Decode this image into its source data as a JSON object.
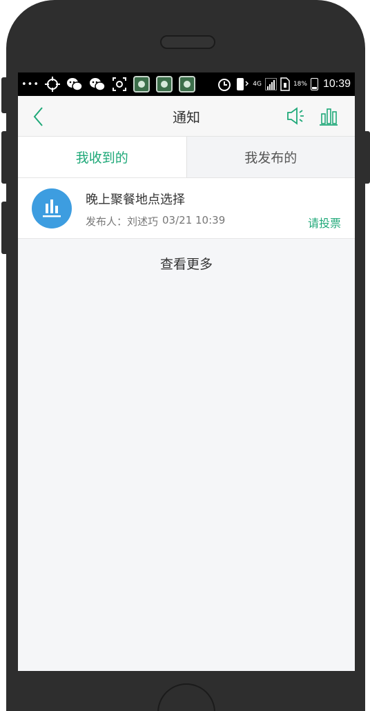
{
  "status_bar": {
    "icons": [
      "more-dots-icon",
      "gps-icon",
      "wechat-icon",
      "wechat-icon",
      "screenshot-icon",
      "app-icon",
      "app-icon",
      "app-icon",
      "alarm-icon",
      "vibrate-icon",
      "signal-icon",
      "sim-icon",
      "battery-icon"
    ],
    "network_label": "4G",
    "battery_percent": "18%",
    "time": "10:39"
  },
  "header": {
    "title": "通知",
    "back_icon": "chevron-left-icon",
    "right_icons": [
      "speaker-icon",
      "bar-chart-icon"
    ]
  },
  "tabs": [
    {
      "label": "我收到的",
      "active": true
    },
    {
      "label": "我发布的",
      "active": false
    }
  ],
  "notices": [
    {
      "icon": "bar-chart-icon",
      "title": "晚上聚餐地点选择",
      "publisher_label": "发布人：刘述巧",
      "time": "03/21 10:39",
      "action": "请投票"
    }
  ],
  "more_label": "查看更多",
  "colors": {
    "accent": "#1ea878",
    "avatar_bg": "#3d9de0",
    "background": "#f5f6f8"
  }
}
